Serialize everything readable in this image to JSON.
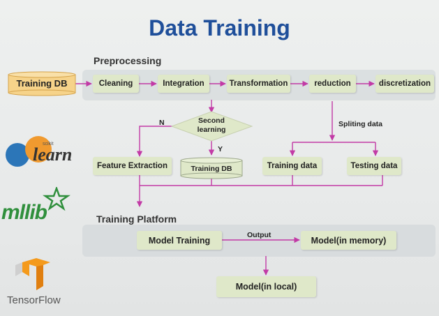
{
  "title": "Data Training",
  "preprocessing": {
    "label": "Preprocessing",
    "source": "Training DB",
    "steps": [
      "Cleaning",
      "Integration",
      "Transformation",
      "reduction",
      "discretization"
    ]
  },
  "decision": {
    "text": "Second\nlearning",
    "no_label": "N",
    "yes_label": "Y"
  },
  "middle": {
    "feature_extraction": "Feature Extraction",
    "training_db": "Training DB",
    "splitting_label": "Spliting data",
    "training_data": "Training data",
    "testing_data": "Testing data"
  },
  "platform": {
    "label": "Training Platform",
    "model_training": "Model Training",
    "output_label": "Output",
    "model_memory": "Model(in memory)",
    "model_local": "Model(in local)"
  },
  "logos": {
    "sklearn": {
      "small_text": "scikit",
      "text": "learn"
    },
    "mllib": "mllib",
    "tensorflow": "TensorFlow"
  },
  "colors": {
    "title": "#1f4f9a",
    "arrow": "#c23aa6",
    "box": "#dfe8c9",
    "db_fill": "#f6d38a",
    "db_stroke": "#d4a24a",
    "sklearn_orange": "#f09a2f",
    "sklearn_blue": "#2c76b8",
    "mllib_green": "#2f8f3c",
    "tf_orange": "#f49a1c"
  }
}
